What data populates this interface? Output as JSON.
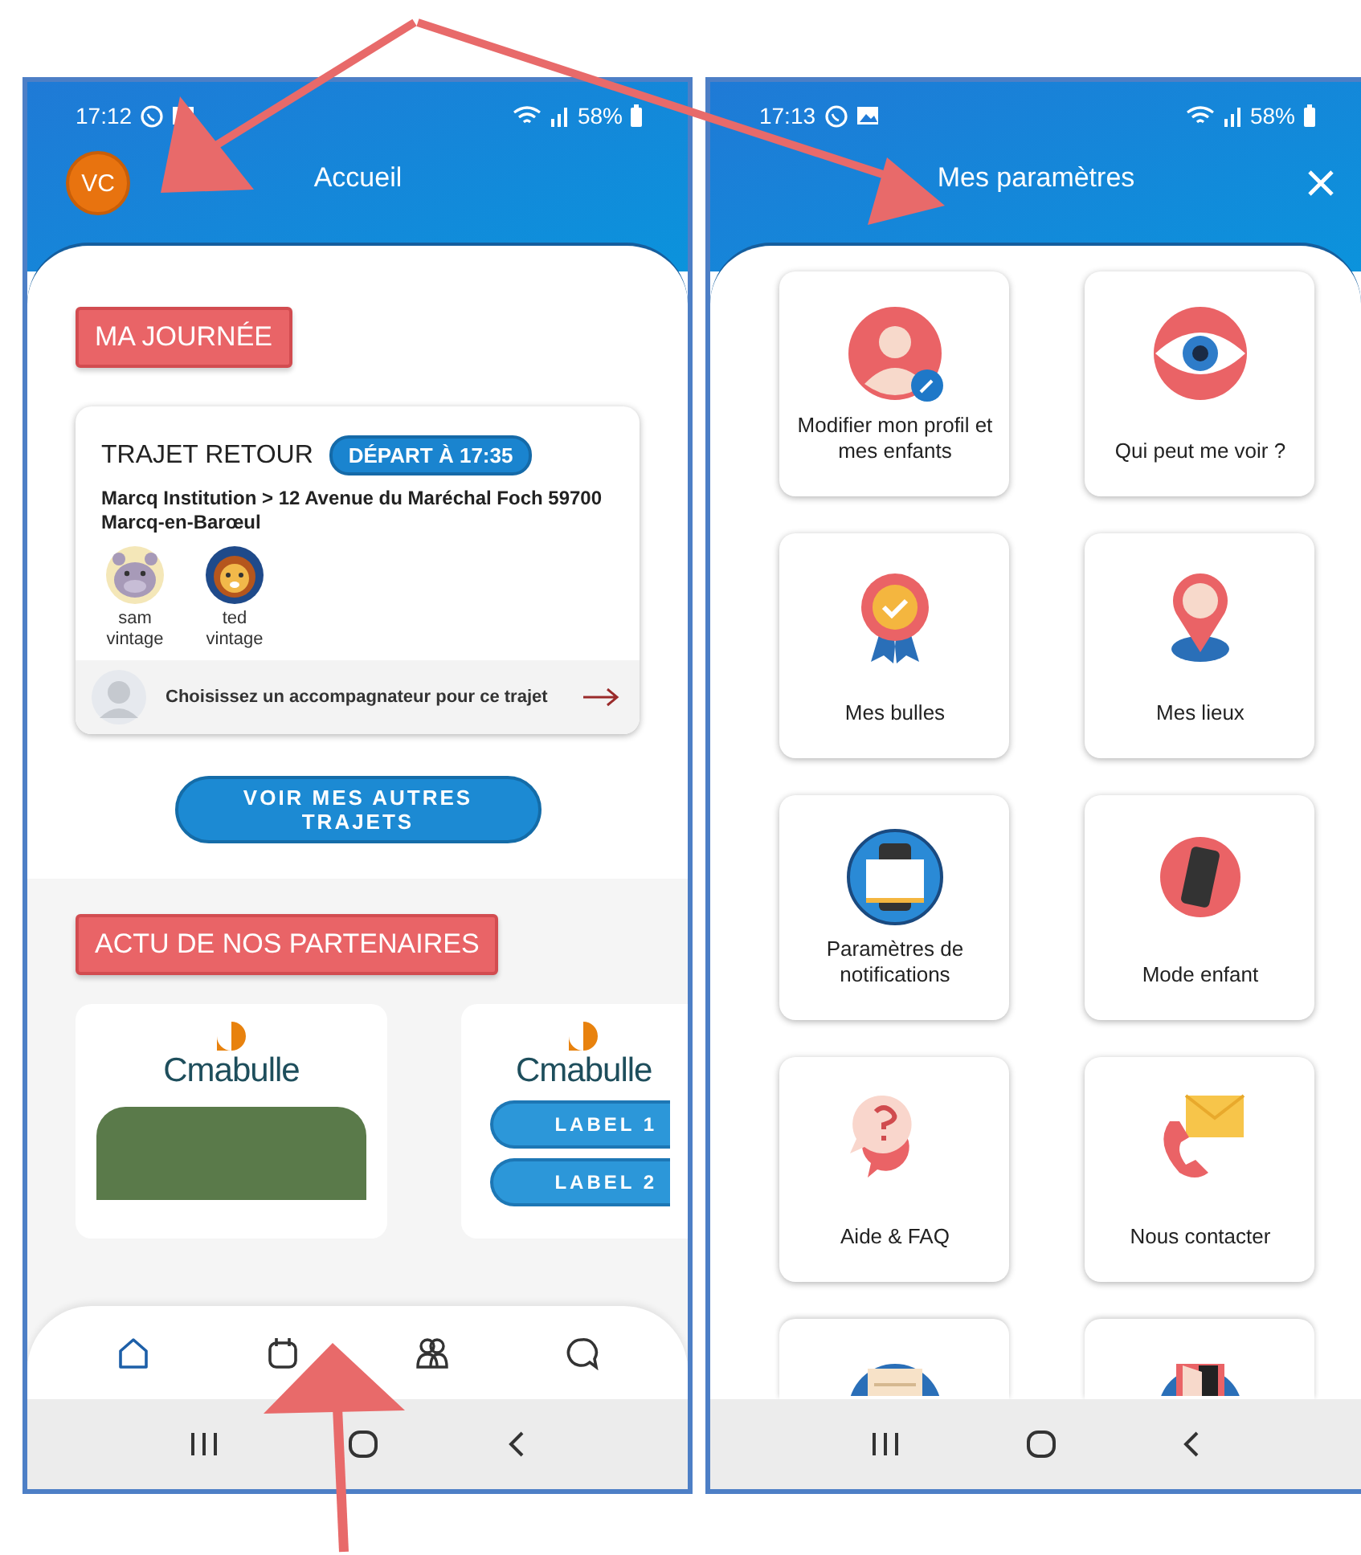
{
  "home_screen": {
    "status_bar": {
      "time": "17:12",
      "battery": "58%"
    },
    "avatar": "VC",
    "title": "Accueil",
    "section_title": "MA JOURNÉE",
    "trip": {
      "title": "TRAJET RETOUR",
      "badge": "DÉPART À 17:35",
      "route": "Marcq Institution > 12 Avenue du Maréchal Foch 59700 Marcq-en-Barœul",
      "children": [
        {
          "first_name": "sam",
          "last_name": "vintage",
          "kind": "hippo"
        },
        {
          "first_name": "ted",
          "last_name": "vintage",
          "kind": "lion"
        }
      ],
      "companion_prompt": "Choisissez un accompagnateur pour ce trajet"
    },
    "more_button": "VOIR MES AUTRES TRAJETS",
    "partners_title": "ACTU DE NOS PARTENAIRES",
    "partner_cards": [
      {
        "logo": "Cmabulle",
        "kind": "photo"
      },
      {
        "logo": "Cmabulle",
        "kind": "labels",
        "labels": [
          "LABEL 1",
          "LABEL 2"
        ]
      }
    ],
    "tab_bar": [
      {
        "kind": "home",
        "selected": true
      },
      {
        "kind": "calendar",
        "selected": false
      },
      {
        "kind": "people",
        "selected": false
      },
      {
        "kind": "chat",
        "selected": false
      }
    ]
  },
  "settings_screen": {
    "status_bar": {
      "time": "17:13",
      "battery": "58%"
    },
    "title": "Mes paramètres",
    "tiles": [
      {
        "kind": "profile",
        "label": "Modifier mon profil et mes enfants"
      },
      {
        "kind": "eye",
        "label": "Qui peut me voir ?"
      },
      {
        "kind": "badge",
        "label": "Mes bulles"
      },
      {
        "kind": "pin",
        "label": "Mes lieux"
      },
      {
        "kind": "book",
        "label": "Paramètres de notifications"
      },
      {
        "kind": "phone",
        "label": "Mode enfant"
      },
      {
        "kind": "help",
        "label": "Aide & FAQ"
      },
      {
        "kind": "contact",
        "label": "Nous contacter"
      },
      {
        "kind": "document"
      },
      {
        "kind": "door"
      }
    ]
  }
}
